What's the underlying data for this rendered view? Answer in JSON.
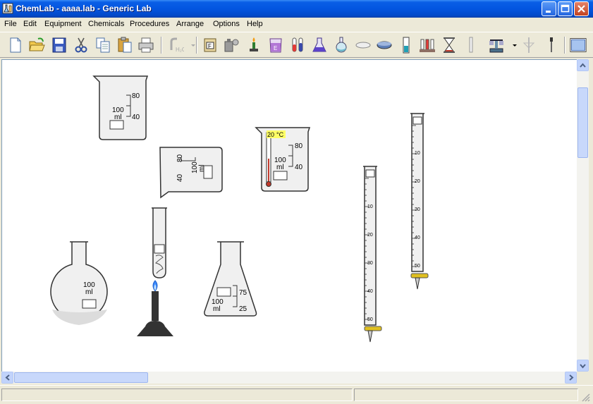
{
  "window": {
    "title": "ChemLab - aaaa.lab - Generic Lab"
  },
  "menu": [
    "File",
    "Edit",
    "Equipment",
    "Chemicals",
    "Procedures",
    "Arrange",
    "Options",
    "Help"
  ],
  "toolbar_icons": [
    "new-file-icon",
    "open-folder-icon",
    "save-disk-icon",
    "cut-scissors-icon",
    "copy-icon",
    "paste-icon",
    "print-icon",
    "water-tap-icon",
    "label-icon",
    "chemical-bottle-icon",
    "bunsen-burner-icon",
    "beaker-icon",
    "test-tube-icon",
    "flask-icon",
    "round-flask-icon",
    "watch-glass-icon",
    "evaporating-dish-icon",
    "thermometer-icon",
    "test-tube-rack-icon",
    "hourglass-icon",
    "pipette-icon",
    "balance-icon",
    "filter-icon",
    "dropper-icon",
    "window-view-icon"
  ],
  "colors": {
    "accent": "#0355e0",
    "flame": "#3d8bff",
    "thermo_label_bg": "#ffff66"
  },
  "lab": {
    "beaker1": {
      "mark_top": "80",
      "mark_mid": "40",
      "capacity": "100",
      "unit": "ml"
    },
    "beaker2": {
      "mark_top": "40",
      "mark_mid": "80",
      "capacity": "100",
      "unit": "ml"
    },
    "beaker3": {
      "mark_top": "80",
      "mark_mid": "40",
      "capacity": "100",
      "unit": "ml",
      "temp_value": "20",
      "temp_unit": "°C"
    },
    "flask": {
      "capacity": "100",
      "unit": "ml"
    },
    "erlenmeyer": {
      "mark_top": "75",
      "mark_low": "25",
      "capacity": "100",
      "unit": "ml"
    },
    "burette1": {
      "ticks": [
        "10",
        "20",
        "30",
        "40",
        "50"
      ]
    },
    "burette2": {
      "ticks": [
        "10",
        "20",
        "30",
        "40",
        "50"
      ]
    }
  }
}
